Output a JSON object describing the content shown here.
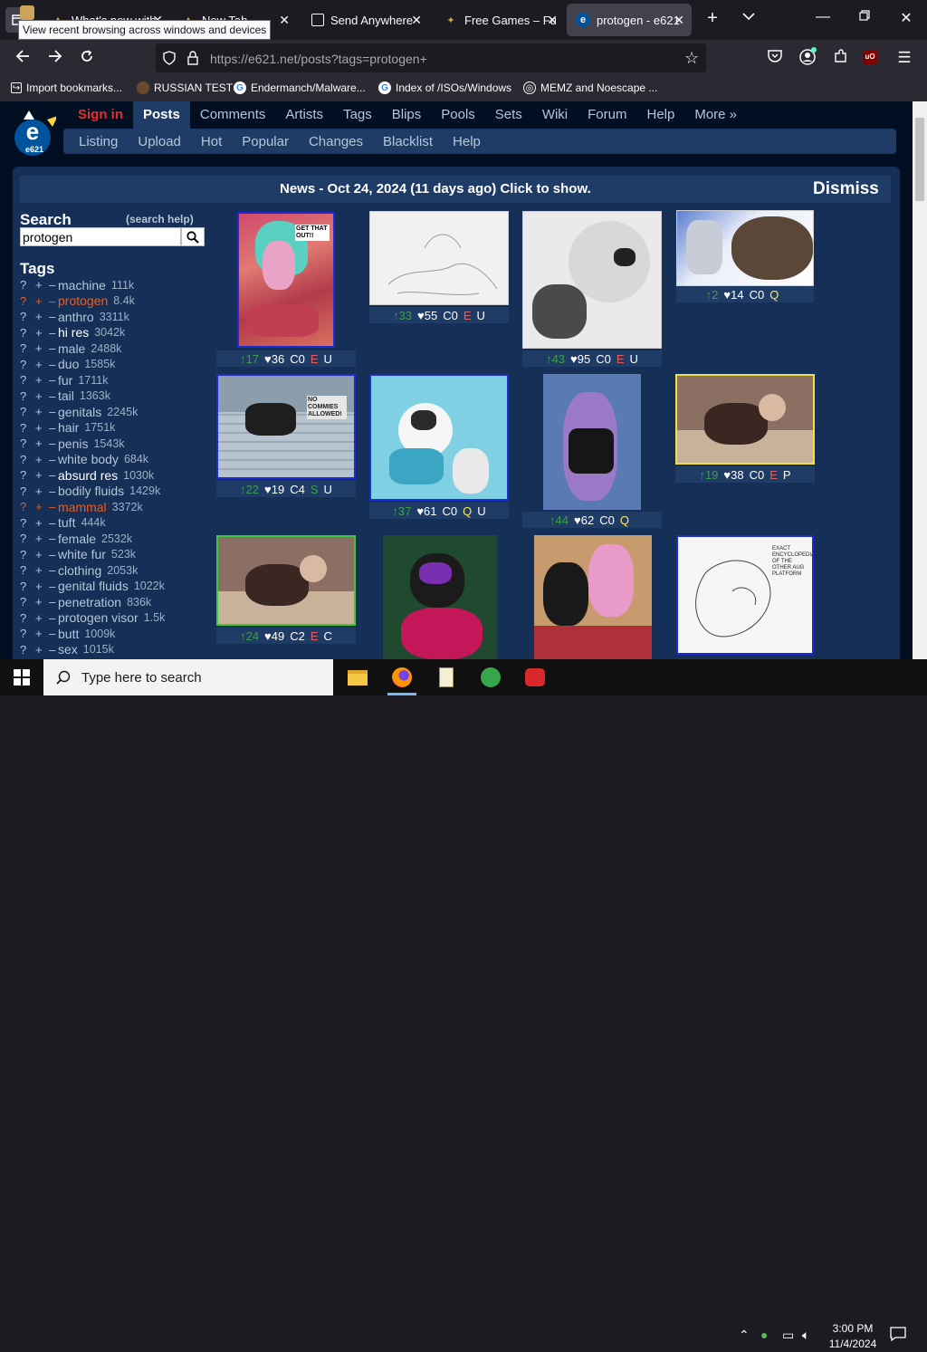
{
  "browser": {
    "tooltip": "View recent browsing across windows and devices",
    "tabs": [
      {
        "title": "What's new with",
        "active": false
      },
      {
        "title": "New Tab",
        "active": false
      },
      {
        "title": "Send Anywhere",
        "active": false
      },
      {
        "title": "Free Games – Fu",
        "active": false
      },
      {
        "title": "protogen - e621",
        "active": true
      }
    ],
    "url_host": "https://e621.net",
    "url_path": "/posts?tags=protogen+",
    "bookmarks": [
      {
        "label": "Import bookmarks...",
        "icon": "import-icon"
      },
      {
        "label": "RUSSIAN TEST",
        "icon": "bookmark-favicon"
      },
      {
        "label": "Endermanch/Malware...",
        "icon": "google-icon"
      },
      {
        "label": "Index of /ISOs/Windows",
        "icon": "google-icon"
      },
      {
        "label": "MEMZ and Noescape ...",
        "icon": "globe-icon"
      }
    ]
  },
  "site": {
    "logo_text": "e621",
    "main_nav": [
      "Sign in",
      "Posts",
      "Comments",
      "Artists",
      "Tags",
      "Blips",
      "Pools",
      "Sets",
      "Wiki",
      "Forum",
      "Help",
      "More »"
    ],
    "sub_nav": [
      "Listing",
      "Upload",
      "Hot",
      "Popular",
      "Changes",
      "Blacklist",
      "Help"
    ],
    "news": "News - Oct 24, 2024 (11 days ago) Click to show.",
    "dismiss": "Dismiss",
    "search_heading": "Search",
    "search_help": "(search help)",
    "search_value": "protogen",
    "tags_heading": "Tags",
    "tag_controls": {
      "wiki": "?",
      "add": "+",
      "remove": "–"
    },
    "tags": [
      {
        "name": "machine",
        "count": "111k",
        "type": "general"
      },
      {
        "name": "protogen",
        "count": "8.4k",
        "type": "species"
      },
      {
        "name": "anthro",
        "count": "3311k",
        "type": "general"
      },
      {
        "name": "hi res",
        "count": "3042k",
        "type": "meta"
      },
      {
        "name": "male",
        "count": "2488k",
        "type": "general"
      },
      {
        "name": "duo",
        "count": "1585k",
        "type": "general"
      },
      {
        "name": "fur",
        "count": "1711k",
        "type": "general"
      },
      {
        "name": "tail",
        "count": "1363k",
        "type": "general"
      },
      {
        "name": "genitals",
        "count": "2245k",
        "type": "general"
      },
      {
        "name": "hair",
        "count": "1751k",
        "type": "general"
      },
      {
        "name": "penis",
        "count": "1543k",
        "type": "general"
      },
      {
        "name": "white body",
        "count": "684k",
        "type": "general"
      },
      {
        "name": "absurd res",
        "count": "1030k",
        "type": "meta"
      },
      {
        "name": "bodily fluids",
        "count": "1429k",
        "type": "general"
      },
      {
        "name": "mammal",
        "count": "3372k",
        "type": "species"
      },
      {
        "name": "tuft",
        "count": "444k",
        "type": "general"
      },
      {
        "name": "female",
        "count": "2532k",
        "type": "general"
      },
      {
        "name": "white fur",
        "count": "523k",
        "type": "general"
      },
      {
        "name": "clothing",
        "count": "2053k",
        "type": "general"
      },
      {
        "name": "genital fluids",
        "count": "1022k",
        "type": "general"
      },
      {
        "name": "penetration",
        "count": "836k",
        "type": "general"
      },
      {
        "name": "protogen visor",
        "count": "1.5k",
        "type": "general"
      },
      {
        "name": "butt",
        "count": "1009k",
        "type": "general"
      },
      {
        "name": "sex",
        "count": "1015k",
        "type": "general"
      }
    ],
    "posts": [
      {
        "up": "↑17",
        "favs": "♥36",
        "comments": "C0",
        "rating": "E",
        "status": "U"
      },
      {
        "up": "↑33",
        "favs": "♥55",
        "comments": "C0",
        "rating": "E",
        "status": "U"
      },
      {
        "up": "↑43",
        "favs": "♥95",
        "comments": "C0",
        "rating": "E",
        "status": "U"
      },
      {
        "up": "↑2",
        "favs": "♥14",
        "comments": "C0",
        "rating": "Q",
        "status": ""
      },
      {
        "up": "↑22",
        "favs": "♥19",
        "comments": "C4",
        "rating": "S",
        "status": "U"
      },
      {
        "up": "↑37",
        "favs": "♥61",
        "comments": "C0",
        "rating": "Q",
        "status": "U"
      },
      {
        "up": "↑44",
        "favs": "♥62",
        "comments": "C0",
        "rating": "Q",
        "status": ""
      },
      {
        "up": "↑19",
        "favs": "♥38",
        "comments": "C0",
        "rating": "E",
        "status": "P"
      },
      {
        "up": "↑24",
        "favs": "♥49",
        "comments": "C2",
        "rating": "E",
        "status": "C"
      }
    ],
    "thumb_text": {
      "t1": "GET THAT OUT!!",
      "t2": "NO COMMIES ALLOWED!",
      "t3": "EXACT ENCYCLOPEDIA OF THE OTHER AUG PLATFORM"
    }
  },
  "taskbar": {
    "search_placeholder": "Type here to search",
    "time": "3:00 PM",
    "date": "11/4/2024"
  },
  "colors": {
    "page_bg": "#020f23",
    "panel_bg": "#152f56",
    "nav_bg": "#1f3c67",
    "link": "#b4c7d9",
    "species_tag": "#ed5d1f",
    "sign_in": "#e22f2f",
    "rating_e": "#e45f5f",
    "rating_q": "#ffe666",
    "rating_s": "#3e9e49"
  }
}
